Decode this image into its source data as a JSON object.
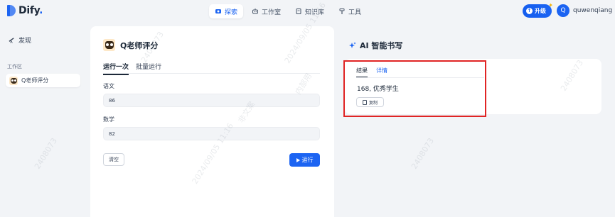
{
  "brand": {
    "name": "Dify",
    "dot": "."
  },
  "nav": [
    {
      "label": "探索",
      "icon": "explore-icon",
      "active": true
    },
    {
      "label": "工作室",
      "icon": "robot-icon",
      "active": false
    },
    {
      "label": "知识库",
      "icon": "book-icon",
      "active": false
    },
    {
      "label": "工具",
      "icon": "hammer-icon",
      "active": false
    }
  ],
  "header": {
    "upgrade_label": "升级",
    "avatar_initial": "Q",
    "username": "quwenqiang"
  },
  "sidebar": {
    "discover_label": "发现",
    "section_label": "工作区",
    "app_label": "Q老师评分"
  },
  "app": {
    "title": "Q老师评分",
    "tabs": [
      {
        "label": "运行一次",
        "active": true
      },
      {
        "label": "批量运行",
        "active": false
      }
    ],
    "fields": [
      {
        "label": "语文",
        "value": "86"
      },
      {
        "label": "数学",
        "value": "82"
      }
    ],
    "clear_label": "清空",
    "run_label": "运行"
  },
  "result": {
    "title": "AI 智能书写",
    "tabs": [
      {
        "label": "结果",
        "active": true
      },
      {
        "label": "详情",
        "active": false
      }
    ],
    "text": "168, 优秀学生",
    "copy_label": "复制"
  },
  "watermark": {
    "lines": [
      "2408073",
      "2024/09/05 11:16",
      "内部用",
      "非文案"
    ]
  },
  "colors": {
    "accent": "#1c64f2",
    "highlight": "#e02424",
    "background": "#f2f4f7"
  }
}
